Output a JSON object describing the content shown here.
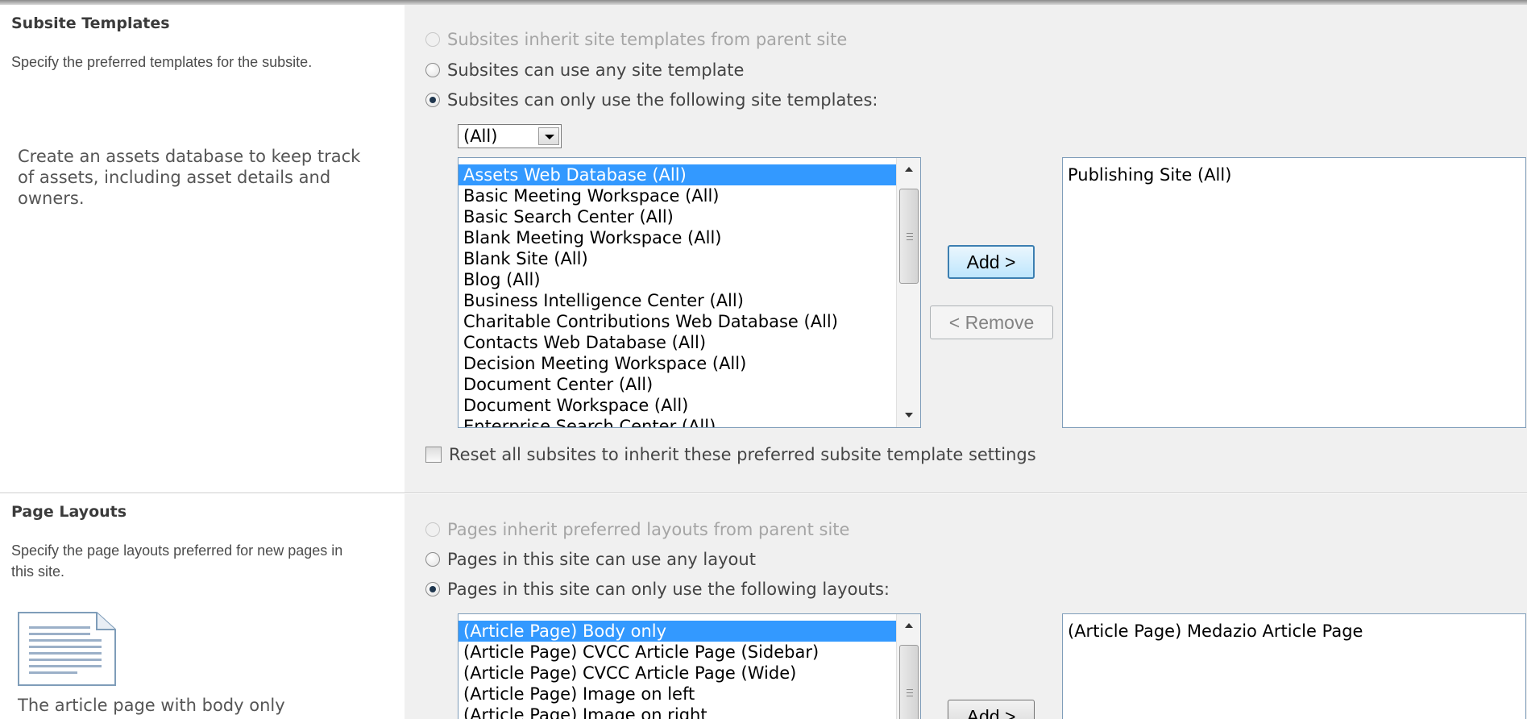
{
  "subsite_templates": {
    "title": "Subsite Templates",
    "description": "Specify the preferred templates for the subsite.",
    "detail": "Create an assets database to keep track of assets, including asset details and owners.",
    "options": [
      {
        "label": "Subsites inherit site templates from parent site",
        "state": "disabled"
      },
      {
        "label": "Subsites can use any site template",
        "state": "unchecked"
      },
      {
        "label": "Subsites can only use the following site templates:",
        "state": "checked"
      }
    ],
    "language_filter": "(All)",
    "available": [
      "Assets Web Database (All)",
      "Basic Meeting Workspace (All)",
      "Basic Search Center (All)",
      "Blank Meeting Workspace (All)",
      "Blank Site (All)",
      "Blog (All)",
      "Business Intelligence Center (All)",
      "Charitable Contributions Web Database (All)",
      "Contacts Web Database (All)",
      "Decision Meeting Workspace (All)",
      "Document Center (All)",
      "Document Workspace (All)",
      "Enterprise Search Center (All)"
    ],
    "selected_item": "Assets Web Database (All)",
    "chosen": [
      "Publishing Site (All)"
    ],
    "add_label": "Add >",
    "remove_label": "< Remove",
    "reset_label": "Reset all subsites to inherit these preferred subsite template settings"
  },
  "page_layouts": {
    "title": "Page Layouts",
    "description": "Specify the page layouts preferred for new pages in this site.",
    "detail": "The article page with body only",
    "options": [
      {
        "label": "Pages inherit preferred layouts from parent site",
        "state": "disabled"
      },
      {
        "label": "Pages in this site can use any layout",
        "state": "unchecked"
      },
      {
        "label": "Pages in this site can only use the following layouts:",
        "state": "checked"
      }
    ],
    "available": [
      "(Article Page) Body only",
      "(Article Page) CVCC Article Page (Sidebar)",
      "(Article Page) CVCC Article Page (Wide)",
      "(Article Page) Image on left",
      "(Article Page) Image on right"
    ],
    "selected_item": "(Article Page) Body only",
    "chosen": [
      "(Article Page) Medazio Article Page"
    ],
    "add_label": "Add >"
  }
}
